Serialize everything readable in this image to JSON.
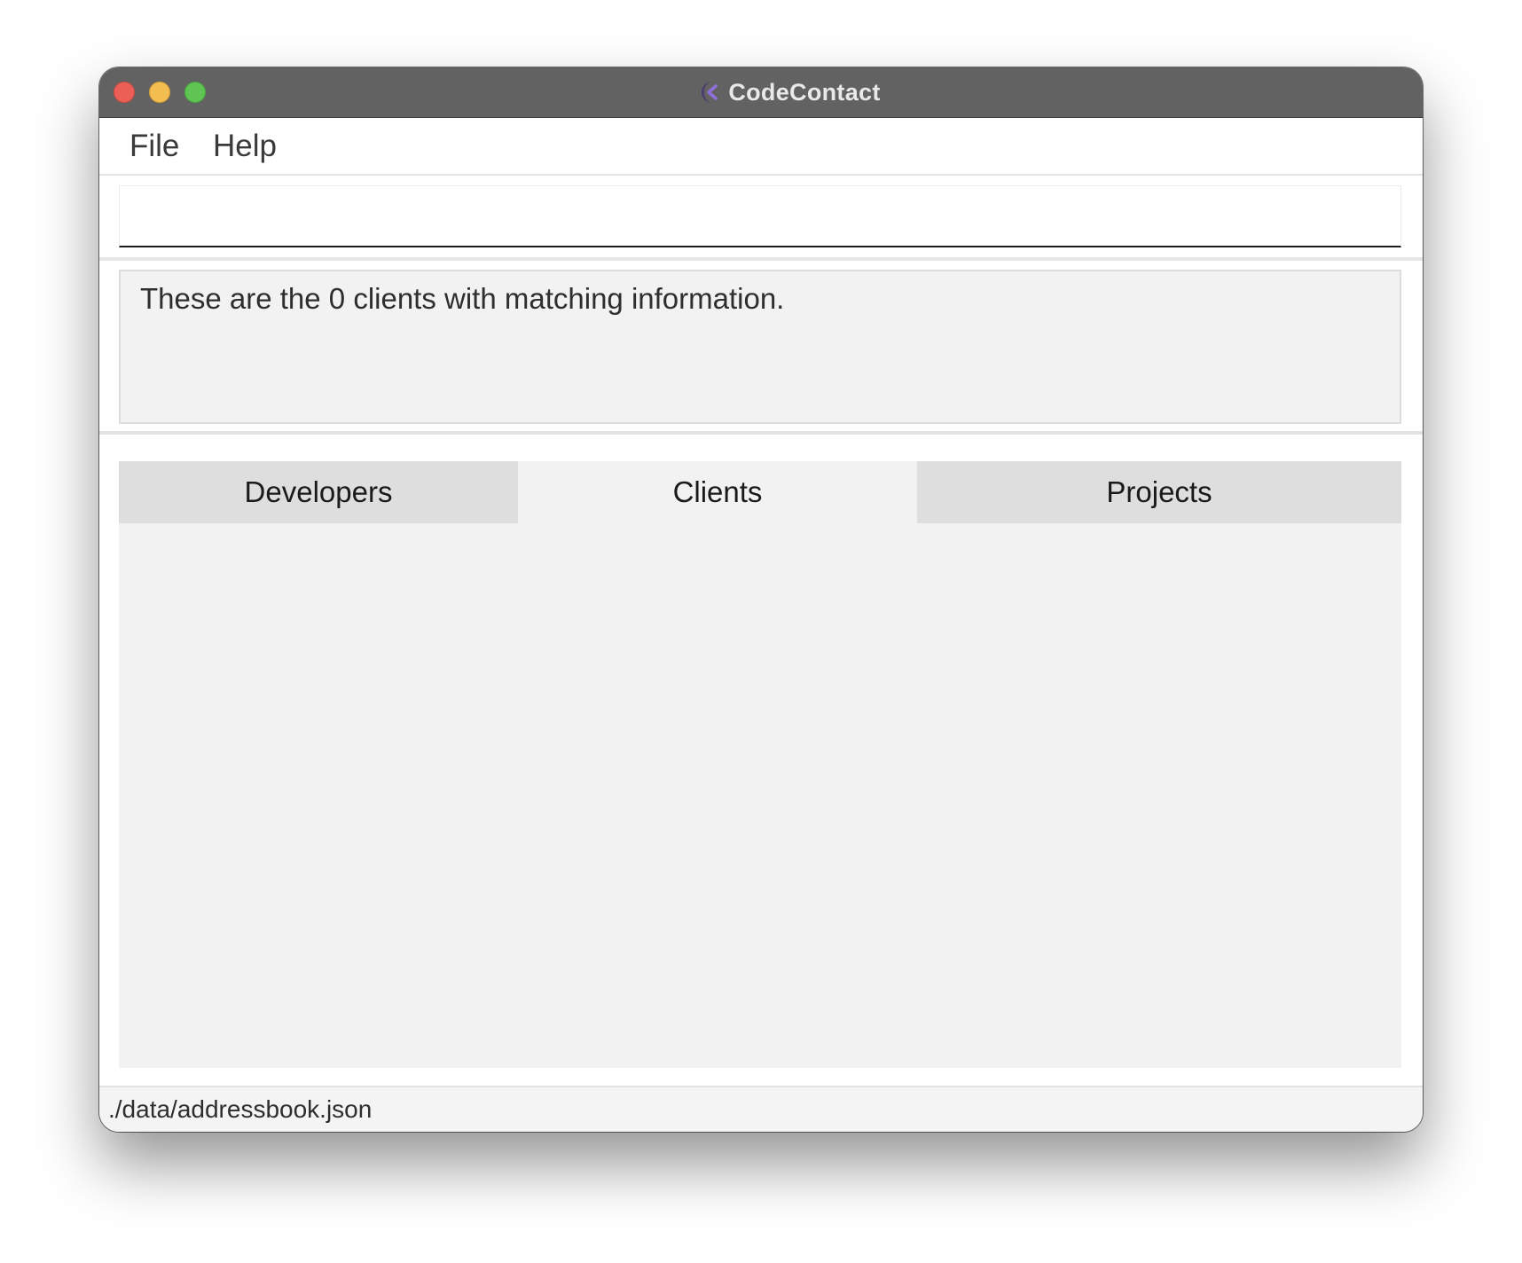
{
  "window": {
    "title": "CodeContact",
    "icon": "codecontact-app-icon"
  },
  "menu": {
    "items": [
      {
        "label": "File"
      },
      {
        "label": "Help"
      }
    ]
  },
  "command": {
    "value": "",
    "placeholder": ""
  },
  "result": {
    "message": "These are the 0 clients with matching information."
  },
  "tabs": {
    "items": [
      {
        "label": "Developers",
        "selected": false
      },
      {
        "label": "Clients",
        "selected": true
      },
      {
        "label": "Projects",
        "selected": false
      }
    ]
  },
  "status": {
    "file_path": "./data/addressbook.json"
  },
  "colors": {
    "titlebar": "#626262",
    "close": "#ec5f56",
    "minimize": "#f4bd4f",
    "maximize": "#5fc454"
  }
}
